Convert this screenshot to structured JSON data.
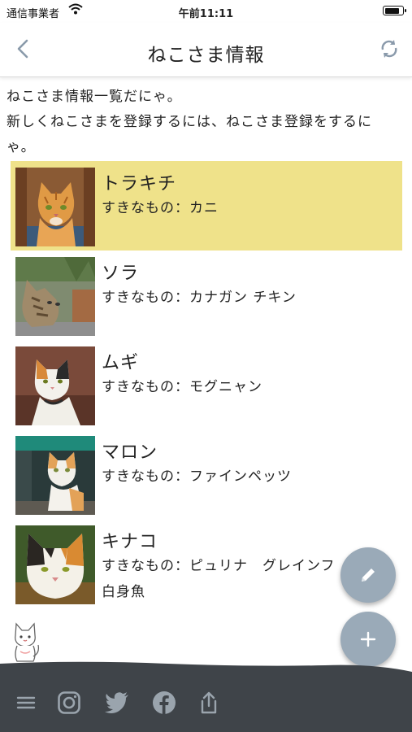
{
  "status_bar": {
    "carrier": "通信事業者",
    "time": "午前11:11",
    "battery_level": 0.85
  },
  "nav": {
    "title": "ねこさま情報"
  },
  "intro": {
    "line1": "ねこさま情報一覧だにゃ。",
    "line2": "新しくねこさまを登録するには、ねこさま登録をするに",
    "line3": "ゃ。"
  },
  "cats": [
    {
      "name": "トラキチ",
      "likes": "すきなもの：カニ",
      "likes_extra": ""
    },
    {
      "name": "ソラ",
      "likes": "すきなもの：カナガン チキン",
      "likes_extra": ""
    },
    {
      "name": "ムギ",
      "likes": "すきなもの：モグニャン",
      "likes_extra": ""
    },
    {
      "name": "マロン",
      "likes": "すきなもの：ファインペッツ",
      "likes_extra": ""
    },
    {
      "name": "キナコ",
      "likes": "すきなもの：ピュリナ　グレインフ",
      "likes_extra": "白身魚"
    }
  ],
  "colors": {
    "selected_row": "#efe28a",
    "fab": "#9aaab8",
    "footer": "#3f4449",
    "accent_icon": "#8a9aab"
  },
  "icons": {
    "back": "chevron-left-icon",
    "refresh": "refresh-icon",
    "edit": "pencil-icon",
    "add": "plus-icon",
    "menu": "hamburger-menu-icon",
    "instagram": "instagram-icon",
    "twitter": "twitter-icon",
    "facebook": "facebook-icon",
    "share": "share-icon"
  }
}
